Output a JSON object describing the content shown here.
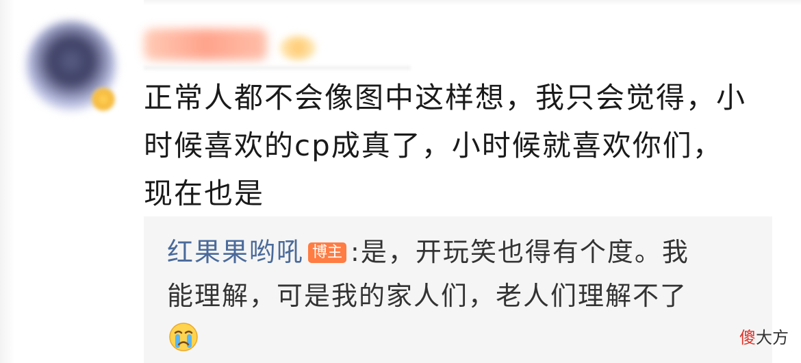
{
  "comment": {
    "line1": "正常人都不会像图中这样想，我只会觉得，小",
    "line2": "时候喜欢的cp成真了，小时候就喜欢你们，",
    "line3": "现在也是"
  },
  "reply": {
    "author": "红果果哟吼",
    "badge": "博主",
    "line1": ":是，开玩笑也得有个度。我",
    "line2": "能理解，可是我的家人们，老人们理解不了",
    "emoji_icon": "crying-face-emoji"
  },
  "watermark": {
    "accent": "傻",
    "rest": "大方"
  },
  "colors": {
    "reply_name": "#4a6a9a",
    "badge_bg": "#ff7c43",
    "watermark_accent": "#e0342a"
  }
}
